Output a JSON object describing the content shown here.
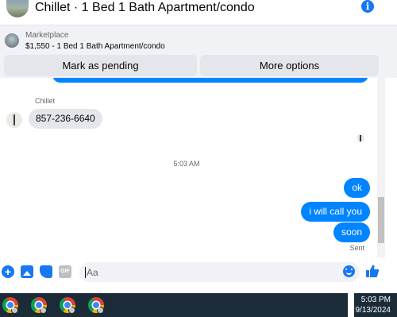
{
  "header": {
    "title": "Chillet · 1 Bed 1 Bath Apartment/condo",
    "info_icon": "info-icon"
  },
  "banner": {
    "label": "Marketplace",
    "listing": "$1,550 - 1 Bed 1 Bath Apartment/condo",
    "mark_pending_label": "Mark as pending",
    "more_options_label": "More options"
  },
  "conversation": {
    "sender_name": "Chillet",
    "received": [
      {
        "text": "857-236-6640"
      }
    ],
    "timestamp": "5:03 AM",
    "sent": [
      {
        "text": "ok"
      },
      {
        "text": "i will call you"
      },
      {
        "text": "soon"
      }
    ],
    "status": "Sent"
  },
  "composer": {
    "placeholder": "Aa",
    "icons": [
      "plus-icon",
      "photo-icon",
      "sticker-icon",
      "gif-icon",
      "emoji-icon",
      "like-icon"
    ],
    "gif_label": "GIF"
  },
  "taskbar": {
    "apps": [
      "chrome-icon",
      "chrome-icon",
      "chrome-icon",
      "chrome-icon"
    ],
    "time": "5:03 PM",
    "date": "9/13/2024"
  },
  "colors": {
    "accent": "#0084ff",
    "brand_blue": "#1877f2",
    "received_bubble": "#e4e6eb",
    "banner_bg": "#f0f2f5",
    "taskbar_bg": "#1c2b38"
  }
}
